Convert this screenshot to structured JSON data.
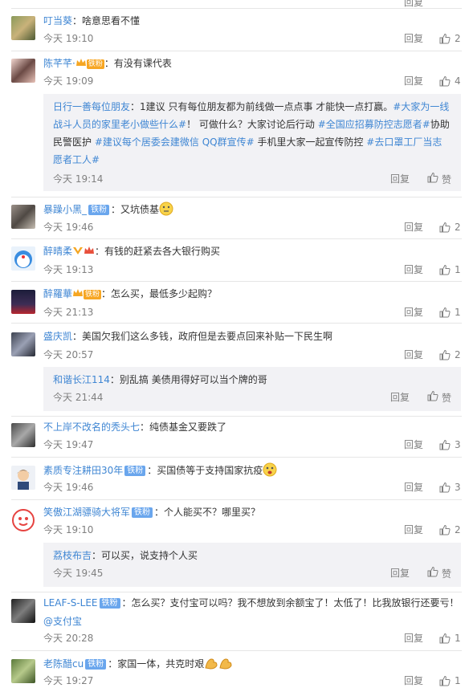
{
  "labels": {
    "reply": "回复",
    "praise": "赞"
  },
  "top_row": {
    "reply": "回复",
    "likes": ""
  },
  "comments": [
    {
      "user": "叮当葵",
      "sep": "：",
      "text": "啥意思看不懂",
      "time": "今天 19:10",
      "likes": "2"
    },
    {
      "user": "陈芊芊·",
      "vip": "铁粉",
      "sep": "：",
      "text": "有没有课代表",
      "time": "今天 19:09",
      "likes": "4"
    },
    {
      "user": "暴躁小黑_",
      "badge": "铁粉",
      "sep": "：",
      "text": "又坑债基",
      "time": "今天 19:46",
      "likes": "2"
    },
    {
      "user": "醉晴柔",
      "sep": "：",
      "text": "有钱的赶紧去各大银行购买",
      "time": "今天 19:13",
      "likes": "1"
    },
    {
      "user": "醉羅華",
      "vip": "铁粉",
      "sep": "：",
      "text": "怎么买，最低多少起购？",
      "time": "今天 21:13",
      "likes": "1"
    },
    {
      "user": "盛庆凯",
      "sep": "：",
      "text": "美国欠我们这么多钱，政府但是去要点回来补贴一下民生啊",
      "time": "今天 20:57",
      "likes": "2"
    },
    {
      "user": "不上岸不改名的秃头七",
      "sep": "：",
      "text": "纯债基金又要跌了",
      "time": "今天 19:47",
      "likes": "3"
    },
    {
      "user": "素质专注耕田30年",
      "badge": "铁粉",
      "sep": "：",
      "text": "买国债等于支持国家抗疫",
      "time": "今天 19:46",
      "likes": "3"
    },
    {
      "user": "笑傲江湖骠骑大将军",
      "badge": "铁粉",
      "sep": "：",
      "text": "个人能买不？哪里买？",
      "time": "今天 19:10",
      "likes": "2"
    },
    {
      "user": "LEAF-S-LEE",
      "badge": "铁粉",
      "sep": "：",
      "text": "怎么买？支付宝可以吗？我不想放到余额宝了！太低了！比我放银行还要亏！",
      "text2": "@支付宝",
      "time": "今天 20:28",
      "likes": "1"
    },
    {
      "user": "老陈醋cu",
      "badge": "铁粉",
      "sep": "：",
      "text": "家国一体，共克时艰",
      "time": "今天 19:27",
      "likes": "1"
    }
  ],
  "subreplies": [
    {
      "user": "日行一善每位朋友",
      "text_a": "：1建议 只有每位朋友都为前线做一点点事 才能快一点打赢。",
      "tag1": "#大家为一线战斗人员的家里老小做些什么#",
      "text_b": "！ 可做什么？大家讨论后行动 ",
      "tag2": "#全国应招募防控志愿者#",
      "text_c": "协助民警医护 ",
      "tag3": "#建议每个居委会建微信 QQ群宣传#",
      "text_d": " 手机里大家一起宣传防控 ",
      "tag4": "#去口罩工厂当志愿者工人#",
      "time": "今天 19:14"
    },
    {
      "user": "和谐长江114",
      "text_a": "：别乱搞 美债用得好可以当个牌的哥",
      "time": "今天 21:44"
    },
    {
      "user": "荔枝布吉",
      "text_a": "：可以买，说支持个人买",
      "time": "今天 19:45"
    }
  ],
  "colors": {
    "accent": "#eb7350",
    "link": "#3f86d3",
    "meta": "#808080",
    "badge": "#6aa6ed"
  }
}
